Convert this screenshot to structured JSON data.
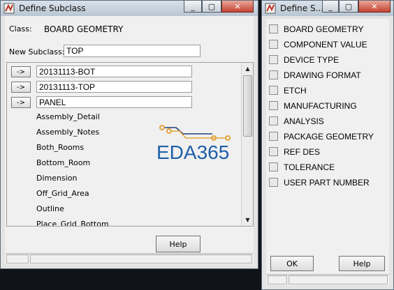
{
  "left_window": {
    "title": "Define Subclass",
    "buttons": {
      "minimize": "_",
      "maximize": "▢",
      "close": "✕"
    },
    "class_label": "Class:",
    "class_value": "BOARD GEOMETRY",
    "new_subclass_label": "New Subclass:",
    "new_subclass_value": "TOP",
    "editable_subclasses": [
      {
        "arrow": "->",
        "value": "20131113-BOT"
      },
      {
        "arrow": "->",
        "value": "20131113-TOP"
      },
      {
        "arrow": "->",
        "value": "PANEL"
      }
    ],
    "fixed_subclasses": [
      "Assembly_Detail",
      "Assembly_Notes",
      "Both_Rooms",
      "Bottom_Room",
      "Dimension",
      "Off_Grid_Area",
      "Outline",
      "Place_Grid_Bottom"
    ],
    "watermark": "EDA365",
    "help_label": "Help"
  },
  "right_window": {
    "title": "Define S...",
    "buttons": {
      "minimize": "_",
      "maximize": "▢",
      "close": "✕"
    },
    "classes": [
      "BOARD GEOMETRY",
      "COMPONENT VALUE",
      "DEVICE TYPE",
      "DRAWING FORMAT",
      "ETCH",
      "MANUFACTURING",
      "ANALYSIS",
      "PACKAGE GEOMETRY",
      "REF DES",
      "TOLERANCE",
      "USER PART NUMBER"
    ],
    "ok_label": "OK",
    "help_label": "Help"
  },
  "colors": {
    "watermark_text": "#1f5fa8",
    "watermark_trace": "#e2a43a",
    "titlebar_top": "#d9e2ea",
    "close_button": "#c5432f"
  }
}
